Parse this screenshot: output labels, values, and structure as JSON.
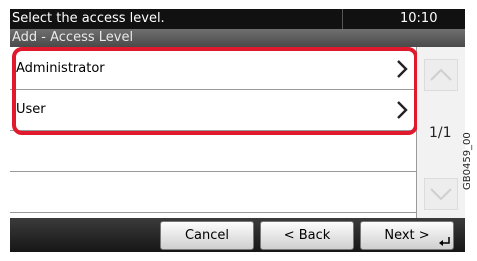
{
  "header": {
    "message": "Select the access level.",
    "time": "10:10"
  },
  "subheader": {
    "title": "Add - Access Level"
  },
  "list": {
    "items": [
      {
        "label": "Administrator"
      },
      {
        "label": "User"
      },
      {
        "label": ""
      },
      {
        "label": ""
      }
    ]
  },
  "pager": {
    "page": "1/1"
  },
  "footer": {
    "cancel": "Cancel",
    "back": "< Back",
    "next": "Next >"
  },
  "side_code": "GB0459_00",
  "colors": {
    "highlight": "#e0192d"
  },
  "icons": [
    "chevron-right-icon",
    "scroll-up-icon",
    "scroll-down-icon",
    "enter-icon"
  ]
}
